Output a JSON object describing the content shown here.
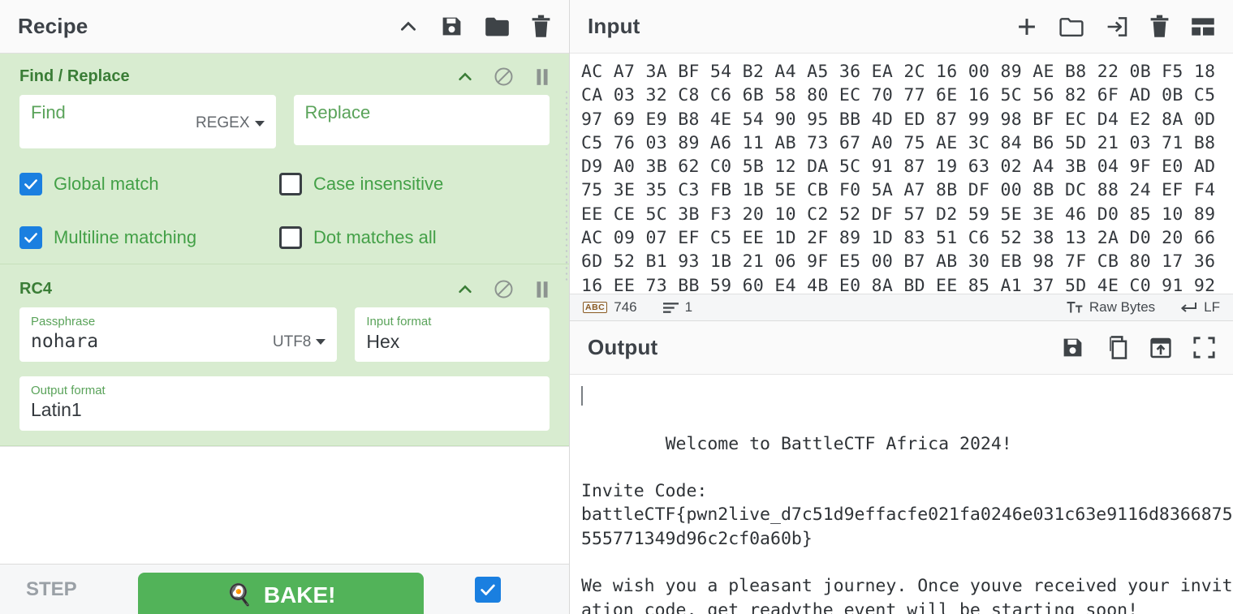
{
  "recipe": {
    "title": "Recipe",
    "header_icons": [
      "chevron-up-icon",
      "save-icon",
      "folder-icon",
      "trash-icon"
    ],
    "operations": [
      {
        "name": "Find / Replace",
        "icons": [
          "chevron-up-icon",
          "disable-icon",
          "pause-icon"
        ],
        "args": [
          {
            "label": "Find",
            "value": "",
            "dropdown": "REGEX"
          },
          {
            "label": "Replace",
            "value": "",
            "dropdown": ""
          }
        ],
        "checkboxes": [
          {
            "label": "Global match",
            "checked": true
          },
          {
            "label": "Case insensitive",
            "checked": false
          },
          {
            "label": "Multiline matching",
            "checked": true
          },
          {
            "label": "Dot matches all",
            "checked": false
          }
        ]
      },
      {
        "name": "RC4",
        "icons": [
          "chevron-up-icon",
          "disable-icon",
          "pause-icon"
        ],
        "args": [
          {
            "label": "Passphrase",
            "value": "nohara",
            "dropdown": "UTF8"
          },
          {
            "label": "Input format",
            "value": "Hex",
            "dropdown": ""
          },
          {
            "label": "Output format",
            "value": "Latin1",
            "dropdown": ""
          }
        ]
      }
    ]
  },
  "controls": {
    "step_label": "STEP",
    "bake_label": "BAKE!",
    "bake_icon": "chef-hat-icon",
    "auto_bake_checked": true,
    "bake_color": "#52b359"
  },
  "input": {
    "title": "Input",
    "header_icons": [
      "plus-icon",
      "folder-open-icon",
      "open-as-input-icon",
      "trash-icon",
      "tabs-layout-icon"
    ],
    "content": "AC A7 3A BF 54 B2 A4 A5 36 EA 2C 16 00 89 AE B8 22 0B F5 18\nCA 03 32 C8 C6 6B 58 80 EC 70 77 6E 16 5C 56 82 6F AD 0B C5\n97 69 E9 B8 4E 54 90 95 BB 4D ED 87 99 98 BF EC D4 E2 8A 0D\nC5 76 03 89 A6 11 AB 73 67 A0 75 AE 3C 84 B6 5D 21 03 71 B8\nD9 A0 3B 62 C0 5B 12 DA 5C 91 87 19 63 02 A4 3B 04 9F E0 AD\n75 3E 35 C3 FB 1B 5E CB F0 5A A7 8B DF 00 8B DC 88 24 EF F4\nEE CE 5C 3B F3 20 10 C2 52 DF 57 D2 59 5E 3E 46 D0 85 10 89\nAC 09 07 EF C5 EE 1D 2F 89 1D 83 51 C6 52 38 13 2A D0 20 66\n6D 52 B1 93 1B 21 06 9F E5 00 B7 AB 30 EB 98 7F CB 80 17 36\n16 EE 73 BB 59 60 E4 4B E0 8A BD EE 85 A1 37 5D 4E C0 91 92",
    "status": {
      "length_icon": "abc-icon",
      "length": "746",
      "lines_icon": "lines-icon",
      "lines": "1",
      "encoding_icon": "text-format-icon",
      "encoding": "Raw Bytes",
      "eol_icon": "enter-icon",
      "eol": "LF"
    }
  },
  "output": {
    "title": "Output",
    "header_icons": [
      "save-icon",
      "copy-icon",
      "replace-input-icon",
      "maximise-icon"
    ],
    "content": "Welcome to BattleCTF Africa 2024!\n\nInvite Code:\nbattleCTF{pwn2live_d7c51d9effacfe021fa0246e031c63e9116d8366875555771349d96c2cf0a60b}\n\nWe wish you a pleasant journey. Once youve received your invitation code, get readythe event will be starting soon!"
  }
}
